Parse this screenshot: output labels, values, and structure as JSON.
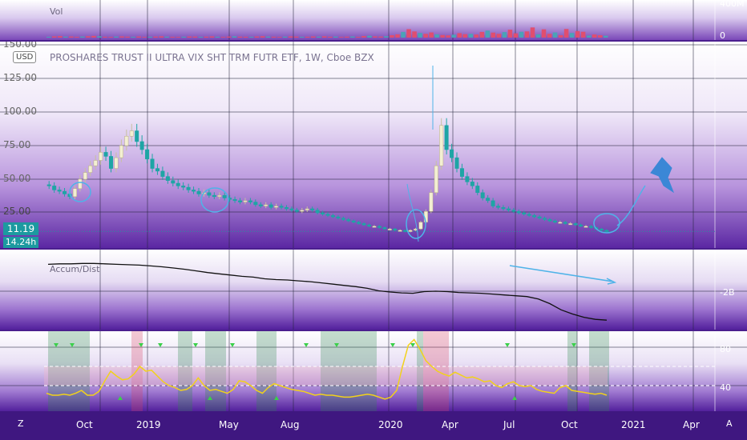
{
  "colors": {
    "up": "#f3efd2",
    "down": "#1ea5a5",
    "vol_up": "#4aa3b6",
    "vol_down": "#e04e6f",
    "ad_line": "#111111",
    "osc_line": "#f2d21a",
    "grid": "#23233a",
    "annot": "#4fb3e8",
    "current_price_bg": "#1c9aa0"
  },
  "volume": {
    "title": "Vol",
    "axis_labels": [
      "400M",
      "0"
    ]
  },
  "price": {
    "title": "PROSHARES TRUST II ULTRA VIX SHT TRM FUTR ETF, 1W, Cboe BZX",
    "currency": "USD",
    "axis_labels": [
      "150.00",
      "125.00",
      "100.00",
      "75.00",
      "50.00",
      "25.00"
    ],
    "current_price": "11.19",
    "next_bar": "14.24h"
  },
  "ad": {
    "title": "Accum/Dist",
    "axis_label": "-2B"
  },
  "osc": {
    "title": "",
    "axis_labels": [
      "80",
      "40"
    ]
  },
  "time_axis": {
    "labels": [
      "Oct",
      "2019",
      "May",
      "Aug",
      "2020",
      "Apr",
      "Jul",
      "Oct",
      "2021",
      "Apr"
    ],
    "left_corner": "Z",
    "right_corner": "A"
  },
  "chart_data": [
    {
      "type": "bar",
      "title": "Vol",
      "series": [
        {
          "name": "Vol",
          "values": [
            10,
            14,
            18,
            11,
            13,
            9,
            12,
            16,
            20,
            15,
            10,
            8,
            12,
            14,
            11,
            9,
            13,
            8,
            10,
            12,
            15,
            11,
            9,
            8,
            10,
            13,
            12,
            9,
            11,
            14,
            10,
            8,
            12,
            15,
            11,
            10,
            9,
            13,
            16,
            12,
            10,
            8,
            11,
            14,
            12,
            9,
            10,
            13,
            11,
            15,
            10,
            12,
            8,
            11,
            13,
            9,
            18,
            22,
            14,
            12,
            16,
            28,
            38,
            66,
            98,
            72,
            54,
            44,
            60,
            38,
            30,
            26,
            34,
            52,
            40,
            44,
            36,
            66,
            82,
            58,
            44,
            64,
            92,
            50,
            68,
            72,
            118,
            38,
            96,
            44,
            60,
            28,
            100,
            54,
            76,
            68,
            24,
            36,
            28,
            22
          ]
        }
      ],
      "ylim": [
        0,
        400
      ],
      "y_unit": "M"
    },
    {
      "type": "candlestick",
      "title": "PROSHARES TRUST II ULTRA VIX SHT TRM FUTR ETF, 1W, Cboe BZX",
      "x_range": [
        "2018-08",
        "2021-05"
      ],
      "ylim": [
        10,
        150
      ],
      "current_price": 11.19,
      "closes": [
        45,
        42,
        41,
        39,
        37,
        43,
        50,
        55,
        60,
        64,
        70,
        67,
        58,
        66,
        75,
        82,
        86,
        78,
        72,
        65,
        58,
        56,
        52,
        49,
        47,
        45,
        44,
        42,
        41,
        39,
        40,
        38,
        37,
        38,
        36,
        35,
        34,
        33,
        34,
        33,
        31,
        30,
        31,
        29,
        30,
        29,
        28,
        27,
        26,
        27,
        28,
        27,
        25,
        24,
        23,
        22,
        21,
        20,
        19,
        18,
        17,
        16,
        15,
        15,
        14,
        13,
        13,
        12,
        12,
        11,
        12,
        13,
        18,
        26,
        40,
        60,
        90,
        72,
        66,
        58,
        52,
        48,
        45,
        40,
        36,
        34,
        30,
        29,
        28,
        27,
        26,
        25,
        24,
        23,
        22,
        21,
        20,
        19,
        18,
        18,
        17,
        17,
        16,
        15,
        15,
        14,
        13,
        12,
        11
      ]
    },
    {
      "type": "line",
      "title": "Accum/Dist",
      "series": [
        {
          "name": "Accum/Dist",
          "values": [
            -1.1,
            -1.09,
            -1.09,
            -1.08,
            -1.08,
            -1.09,
            -1.1,
            -1.11,
            -1.12,
            -1.14,
            -1.16,
            -1.19,
            -1.22,
            -1.26,
            -1.3,
            -1.33,
            -1.36,
            -1.39,
            -1.41,
            -1.45,
            -1.47,
            -1.48,
            -1.5,
            -1.52,
            -1.55,
            -1.58,
            -1.61,
            -1.64,
            -1.68,
            -1.74,
            -1.77,
            -1.79,
            -1.8,
            -1.76,
            -1.75,
            -1.76,
            -1.78,
            -1.79,
            -1.8,
            -1.82,
            -1.84,
            -1.86,
            -1.88,
            -1.94,
            -2.05,
            -2.2,
            -2.3,
            -2.38,
            -2.43,
            -2.45
          ]
        }
      ],
      "ylim": [
        -2.6,
        -0.9
      ],
      "y_unit": "B"
    },
    {
      "type": "line",
      "title": "",
      "series": [
        {
          "name": "",
          "values": [
            32,
            30,
            30,
            31,
            30,
            32,
            35,
            30,
            30,
            34,
            45,
            55,
            50,
            46,
            47,
            52,
            60,
            55,
            56,
            50,
            44,
            40,
            38,
            35,
            36,
            40,
            48,
            40,
            35,
            36,
            34,
            32,
            36,
            45,
            44,
            40,
            35,
            32,
            38,
            42,
            40,
            38,
            36,
            35,
            34,
            32,
            30,
            31,
            30,
            30,
            29,
            28,
            28,
            29,
            30,
            31,
            30,
            28,
            26,
            28,
            35,
            60,
            82,
            88,
            78,
            66,
            60,
            55,
            52,
            50,
            54,
            51,
            48,
            49,
            47,
            44,
            45,
            40,
            38,
            42,
            44,
            40,
            39,
            40,
            36,
            34,
            33,
            32,
            38,
            40,
            35,
            34,
            33,
            32,
            31,
            32,
            30
          ]
        }
      ],
      "ylim": [
        20,
        100
      ]
    }
  ]
}
